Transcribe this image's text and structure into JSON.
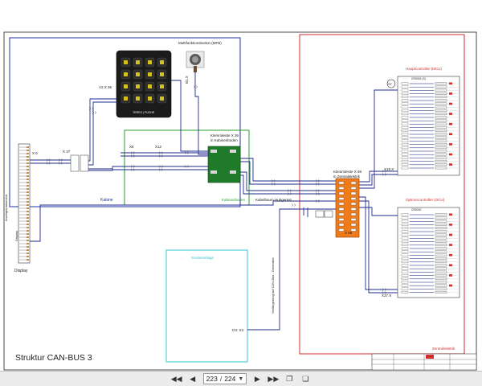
{
  "diagram": {
    "title": "Struktur CAN-BUS 3",
    "mfb_label": "Multifunktionsbutton (MFB)",
    "keypad_brand": "TEREX | FUCHS",
    "a2x36": "A2.X 36",
    "b1x": "B1.X",
    "x6": "X 6",
    "x37": "X 37",
    "x8": "X8",
    "x12": "X12",
    "klemm36_title": "Klemmleiste X 36",
    "klemm36_sub": "in Kabinenboden",
    "kabinenboden": "Kabinenboden",
    "kabine": "Kabine",
    "kabelbaum": "Kabelbaum Hubgerüst",
    "klemm98_title": "Klemmleiste X 98",
    "klemm98_sub": "in Zentralelektrik",
    "x98": "X 98",
    "hauptcontroller": "Hauptcontroller (MCU)",
    "optionscontroller": "Optionscontroller (OCU)",
    "x18": "X18.X",
    "x27": "X27.X",
    "zentralelektrik": "Zentralelektrik",
    "sonderanlage": "Sonderanlage",
    "g3x3": "G3: X3",
    "verlaengerung": "Verlängerung auf CAN-Bus - Generator",
    "display": "Display",
    "display_tag": "Anzeigeinstrument",
    "mcu_model": "CR0032 (S)",
    "ocu_model": "CR0032",
    "st": "ST"
  },
  "toolbar": {
    "current_page": "223",
    "total_pages": "224",
    "separator": "/"
  },
  "colors": {
    "wire_blue": "#1e2a8c",
    "cabin_box": "#2233aa",
    "green_box": "#2a9d2a",
    "red_box": "#d42b2b",
    "cyan_box": "#33c7d6",
    "orange": "#f07b1a",
    "green_block": "#1f7a2a"
  }
}
